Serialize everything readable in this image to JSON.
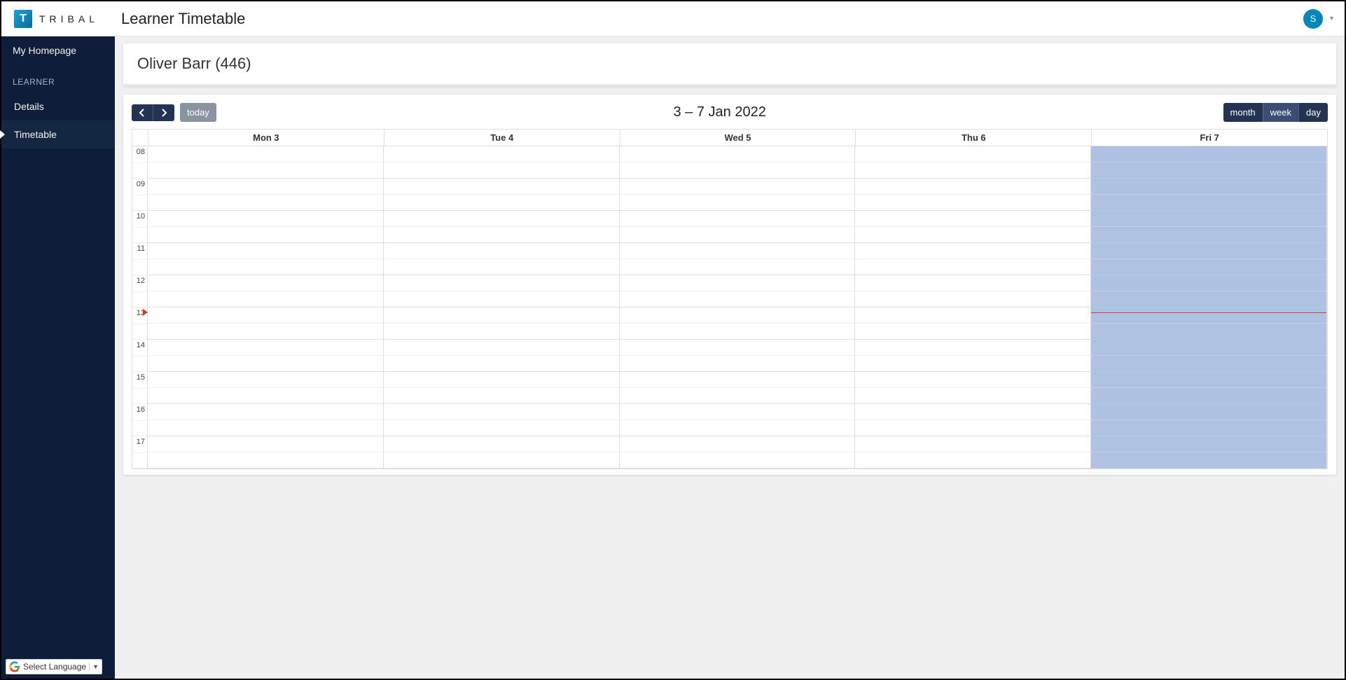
{
  "brand": {
    "glyph": "T",
    "name": "TRIBAL"
  },
  "page_title": "Learner Timetable",
  "avatar_letter": "S",
  "sidebar": {
    "home": "My Homepage",
    "section": "LEARNER",
    "items": [
      {
        "label": "Details",
        "active": false
      },
      {
        "label": "Timetable",
        "active": true
      }
    ]
  },
  "language": {
    "label": "Select Language"
  },
  "learner": {
    "display_name": "Oliver Barr (446)"
  },
  "calendar": {
    "range_label": "3 – 7 Jan 2022",
    "buttons": {
      "today": "today",
      "month": "month",
      "week": "week",
      "day": "day"
    },
    "active_view": "week",
    "days": [
      {
        "label": "Mon 3",
        "is_today": false
      },
      {
        "label": "Tue 4",
        "is_today": false
      },
      {
        "label": "Wed 5",
        "is_today": false
      },
      {
        "label": "Thu 6",
        "is_today": false
      },
      {
        "label": "Fri 7",
        "is_today": true
      }
    ],
    "hours": [
      "08",
      "09",
      "10",
      "11",
      "12",
      "13",
      "14",
      "15",
      "16",
      "17"
    ],
    "now": {
      "hour_index": 5,
      "fraction": 0.15
    }
  }
}
